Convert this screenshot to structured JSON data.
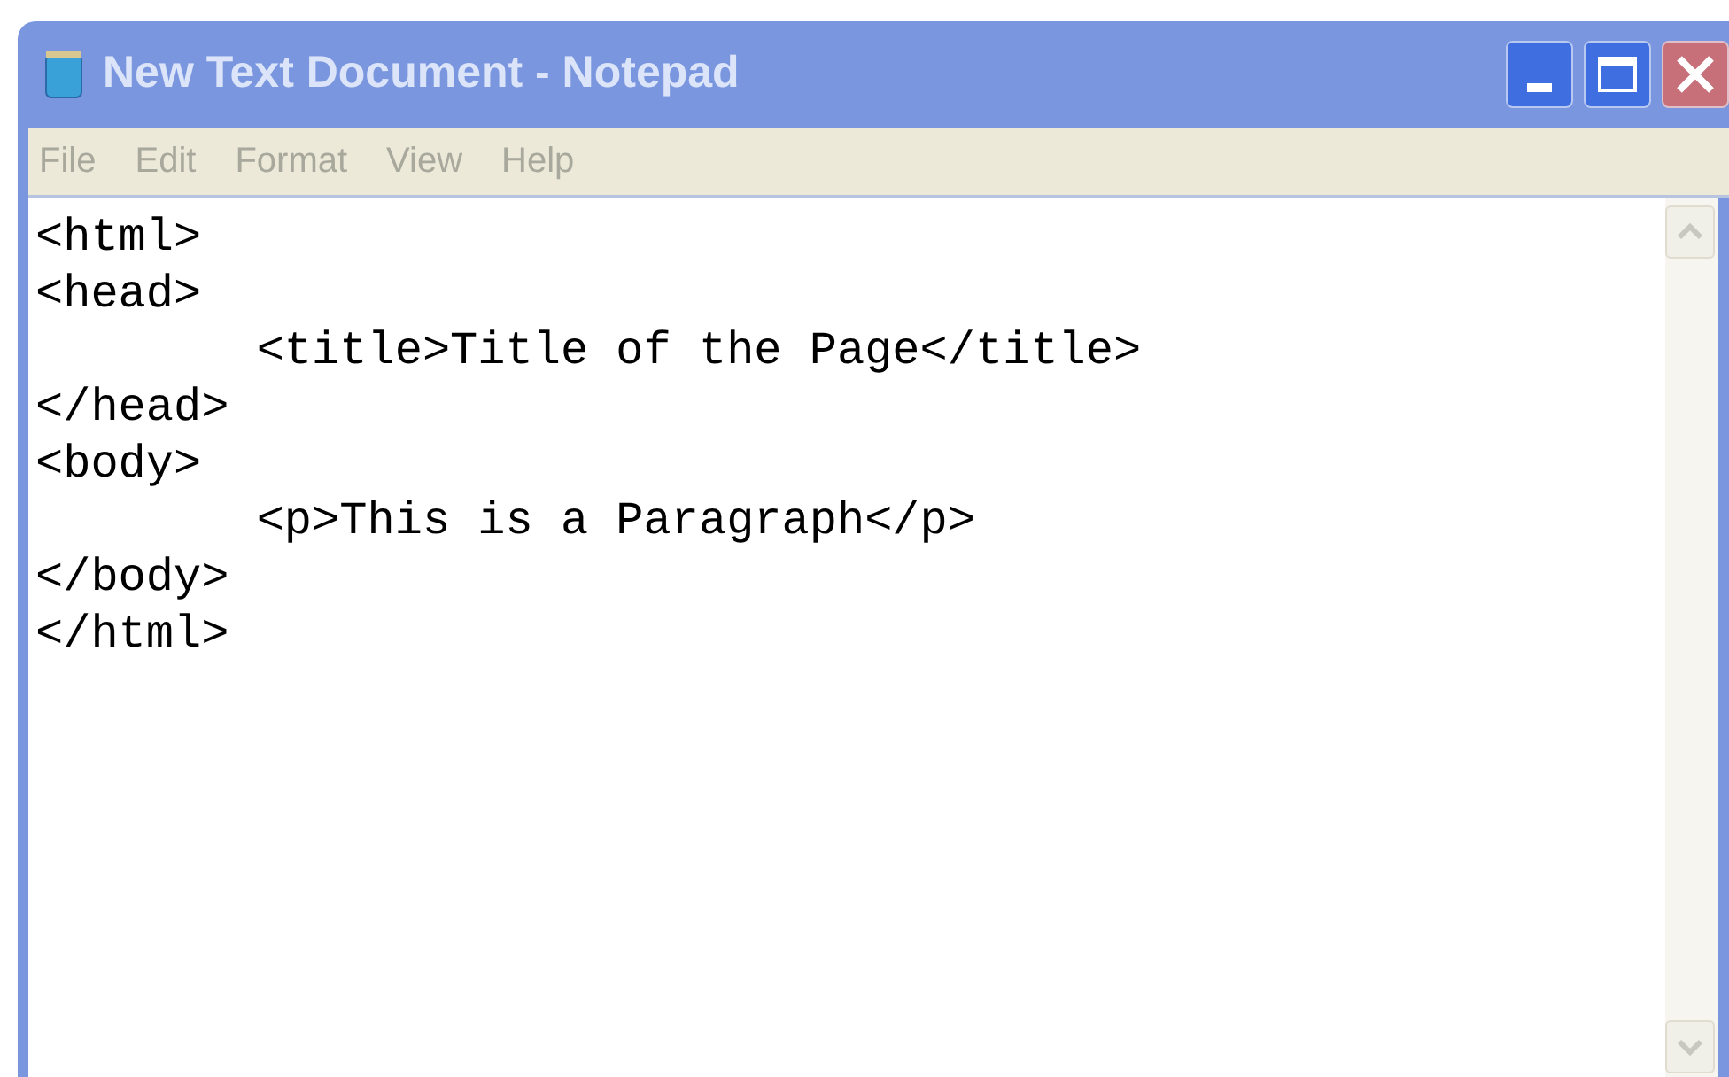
{
  "window": {
    "title": "New Text Document - Notepad",
    "active": false
  },
  "menu": [
    "File",
    "Edit",
    "Format",
    "View",
    "Help"
  ],
  "editor": {
    "lines": [
      "<html>",
      "<head>",
      "\t<title>Title of the Page</title>",
      "</head>",
      "<body>",
      "\t<p>This is a Paragraph</p>",
      "</body>",
      "</html>"
    ]
  }
}
